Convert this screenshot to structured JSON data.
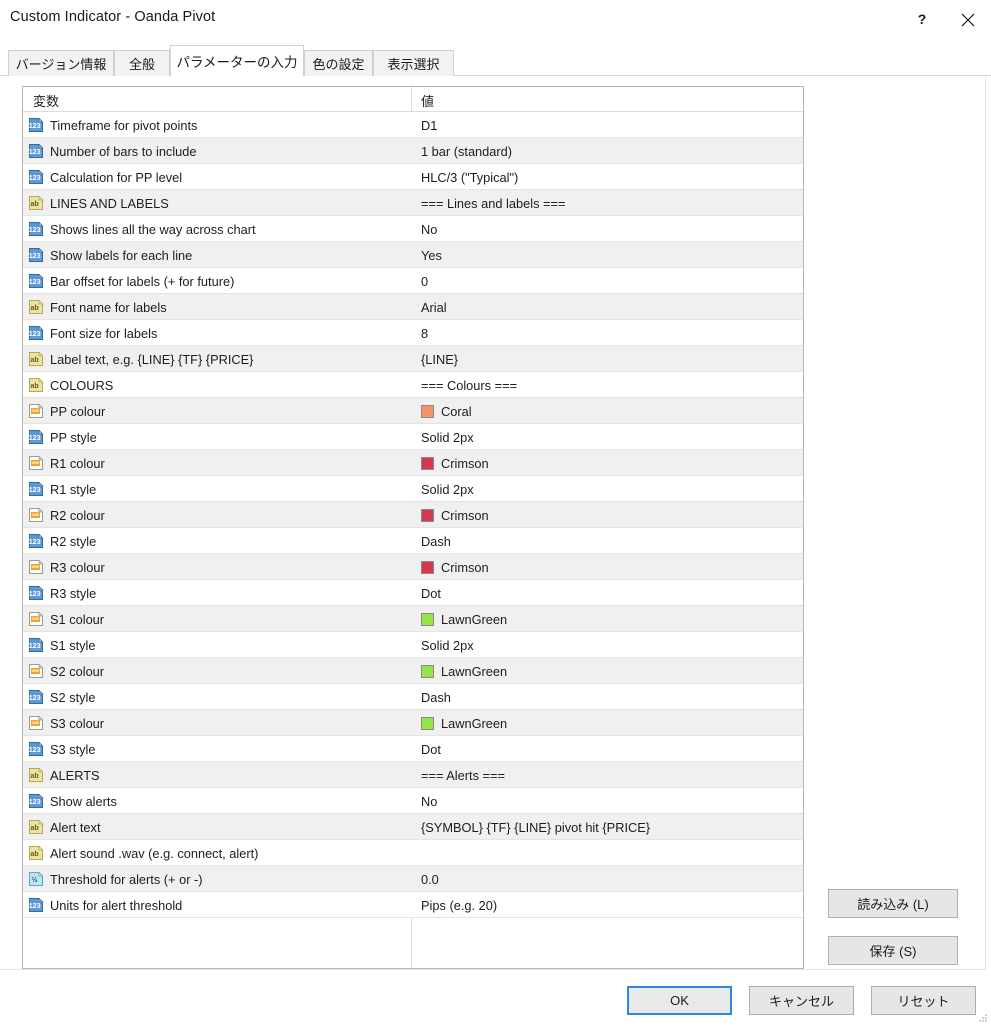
{
  "window": {
    "title": "Custom Indicator - Oanda Pivot",
    "help_label": "?",
    "close_label": "×"
  },
  "tabs": [
    {
      "label": "バージョン情報",
      "active": false
    },
    {
      "label": "全般",
      "active": false
    },
    {
      "label": "パラメーターの入力",
      "active": true
    },
    {
      "label": "色の設定",
      "active": false
    },
    {
      "label": "表示選択",
      "active": false
    }
  ],
  "table": {
    "headers": {
      "variable": "変数",
      "value": "値"
    },
    "rows": [
      {
        "icon": "number-icon",
        "name": "Timeframe for pivot points",
        "value": "D1"
      },
      {
        "icon": "number-icon",
        "name": "Number of bars to include",
        "value": "1 bar (standard)"
      },
      {
        "icon": "number-icon",
        "name": "Calculation for PP level",
        "value": "HLC/3 (\"Typical\")"
      },
      {
        "icon": "text-icon",
        "name": "LINES AND LABELS",
        "value": "=== Lines and labels ==="
      },
      {
        "icon": "number-icon",
        "name": "Shows lines all the way across chart",
        "value": "No"
      },
      {
        "icon": "number-icon",
        "name": "Show labels for each line",
        "value": "Yes"
      },
      {
        "icon": "number-icon",
        "name": "Bar offset for labels (+ for future)",
        "value": "0"
      },
      {
        "icon": "text-icon",
        "name": "Font name for labels",
        "value": "Arial"
      },
      {
        "icon": "number-icon",
        "name": "Font size for labels",
        "value": "8"
      },
      {
        "icon": "text-icon",
        "name": "Label text, e.g. {LINE} {TF} {PRICE}",
        "value": "{LINE}"
      },
      {
        "icon": "text-icon",
        "name": "COLOURS",
        "value": "=== Colours ==="
      },
      {
        "icon": "colour-icon",
        "name": "PP colour",
        "value": "Coral",
        "swatch": "#F4936B"
      },
      {
        "icon": "number-icon",
        "name": "PP style",
        "value": "Solid 2px"
      },
      {
        "icon": "colour-icon",
        "name": "R1 colour",
        "value": "Crimson",
        "swatch": "#D5384E"
      },
      {
        "icon": "number-icon",
        "name": "R1 style",
        "value": "Solid 2px"
      },
      {
        "icon": "colour-icon",
        "name": "R2 colour",
        "value": "Crimson",
        "swatch": "#D5384E"
      },
      {
        "icon": "number-icon",
        "name": "R2 style",
        "value": "Dash"
      },
      {
        "icon": "colour-icon",
        "name": "R3 colour",
        "value": "Crimson",
        "swatch": "#D5384E"
      },
      {
        "icon": "number-icon",
        "name": "R3 style",
        "value": "Dot"
      },
      {
        "icon": "colour-icon",
        "name": "S1 colour",
        "value": "LawnGreen",
        "swatch": "#95E548"
      },
      {
        "icon": "number-icon",
        "name": "S1 style",
        "value": "Solid 2px"
      },
      {
        "icon": "colour-icon",
        "name": "S2 colour",
        "value": "LawnGreen",
        "swatch": "#95E548"
      },
      {
        "icon": "number-icon",
        "name": "S2 style",
        "value": "Dash"
      },
      {
        "icon": "colour-icon",
        "name": "S3 colour",
        "value": "LawnGreen",
        "swatch": "#95E548"
      },
      {
        "icon": "number-icon",
        "name": "S3 style",
        "value": "Dot"
      },
      {
        "icon": "text-icon",
        "name": "ALERTS",
        "value": "=== Alerts ==="
      },
      {
        "icon": "number-icon",
        "name": "Show alerts",
        "value": "No"
      },
      {
        "icon": "text-icon",
        "name": "Alert text",
        "value": "{SYMBOL} {TF} {LINE} pivot hit {PRICE}"
      },
      {
        "icon": "text-icon",
        "name": "Alert sound .wav (e.g. connect, alert)",
        "value": ""
      },
      {
        "icon": "fraction-icon",
        "name": "Threshold for alerts (+ or -)",
        "value": "0.0"
      },
      {
        "icon": "number-icon",
        "name": "Units for alert threshold",
        "value": "Pips (e.g. 20)"
      }
    ]
  },
  "side_buttons": {
    "load": "読み込み (L)",
    "save": "保存 (S)"
  },
  "bottom_buttons": {
    "ok": "OK",
    "cancel": "キャンセル",
    "reset": "リセット"
  },
  "colors": {
    "accent": "#2a8ae0",
    "row_alt": "#f0f0f0",
    "border": "#b5b5b5"
  }
}
